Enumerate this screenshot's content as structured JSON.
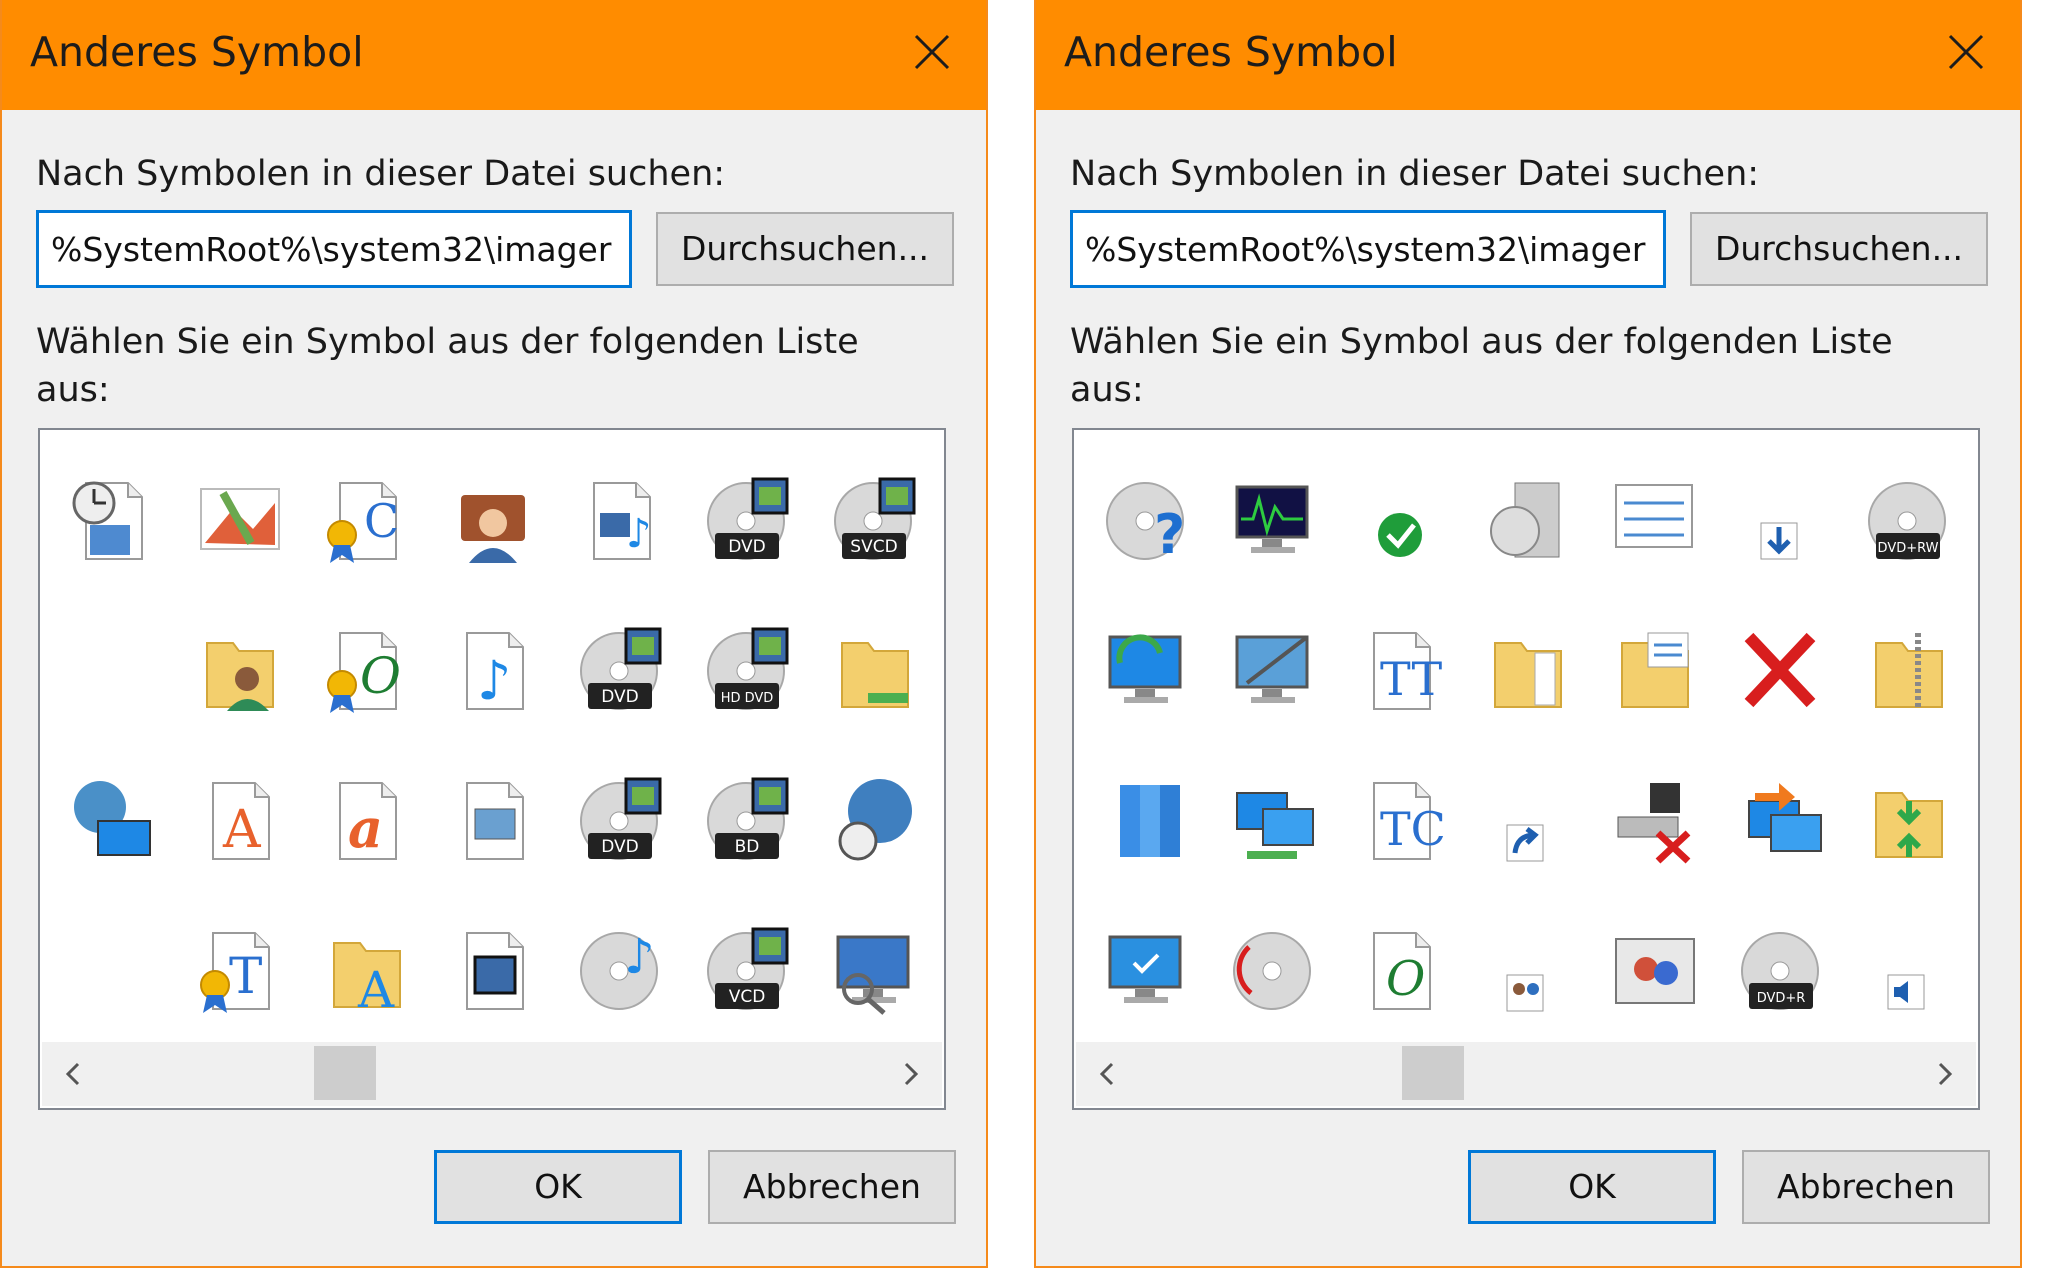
{
  "dialogs": [
    {
      "title": "Anderes Symbol",
      "search_label": "Nach Symbolen in dieser Datei suchen:",
      "path_value": "%SystemRoot%\\system32\\imager",
      "browse_label": "Durchsuchen...",
      "choose_label": "Wählen Sie ein Symbol aus der folgenden Liste aus:",
      "ok_label": "OK",
      "cancel_label": "Abbrechen",
      "icons": [
        {
          "icon": "clock-doc-icon",
          "badge": ""
        },
        {
          "icon": "map-picture-icon",
          "badge": ""
        },
        {
          "icon": "certificate-font-icon",
          "badge": ""
        },
        {
          "icon": "user-briefcase-icon",
          "badge": ""
        },
        {
          "icon": "video-music-doc-icon",
          "badge": ""
        },
        {
          "icon": "dvd-disc-icon",
          "badge": "DVD"
        },
        {
          "icon": "svcd-disc-icon",
          "badge": "SVCD"
        },
        {
          "icon": "blank-icon",
          "badge": ""
        },
        {
          "icon": "user-folder-icon",
          "badge": ""
        },
        {
          "icon": "certificate-opentype-icon",
          "badge": ""
        },
        {
          "icon": "music-doc-icon",
          "badge": ""
        },
        {
          "icon": "dvd-disc-icon",
          "badge": "DVD"
        },
        {
          "icon": "hddvd-disc-icon",
          "badge": "HD DVD"
        },
        {
          "icon": "network-folder-icon",
          "badge": ""
        },
        {
          "icon": "globe-network-icon",
          "badge": ""
        },
        {
          "icon": "font-a-doc-icon",
          "badge": ""
        },
        {
          "icon": "font-italic-a-icon",
          "badge": ""
        },
        {
          "icon": "picture-doc-icon",
          "badge": ""
        },
        {
          "icon": "dvd-disc-icon",
          "badge": "DVD"
        },
        {
          "icon": "bd-disc-icon",
          "badge": "BD"
        },
        {
          "icon": "globe-clock-icon",
          "badge": ""
        },
        {
          "icon": "blank-icon",
          "badge": ""
        },
        {
          "icon": "certificate-truetype-icon",
          "badge": ""
        },
        {
          "icon": "fonts-folder-icon",
          "badge": ""
        },
        {
          "icon": "video-doc-icon",
          "badge": ""
        },
        {
          "icon": "music-disc-icon",
          "badge": ""
        },
        {
          "icon": "vcd-disc-icon",
          "badge": "VCD"
        },
        {
          "icon": "monitor-magnifier-icon",
          "badge": ""
        }
      ]
    },
    {
      "title": "Anderes Symbol",
      "search_label": "Nach Symbolen in dieser Datei suchen:",
      "path_value": "%SystemRoot%\\system32\\imager",
      "browse_label": "Durchsuchen...",
      "choose_label": "Wählen Sie ein Symbol aus der folgenden Liste aus:",
      "ok_label": "OK",
      "cancel_label": "Abbrechen",
      "icons": [
        {
          "icon": "disc-question-icon",
          "badge": ""
        },
        {
          "icon": "performance-monitor-icon",
          "badge": ""
        },
        {
          "icon": "green-check-icon",
          "badge": ""
        },
        {
          "icon": "disc-box-icon",
          "badge": ""
        },
        {
          "icon": "checklist-window-icon",
          "badge": ""
        },
        {
          "icon": "download-arrow-icon",
          "badge": ""
        },
        {
          "icon": "dvdrw-disc-icon",
          "badge": "DVD+RW"
        },
        {
          "icon": "network-sync-icon",
          "badge": ""
        },
        {
          "icon": "monitor-pen-icon",
          "badge": ""
        },
        {
          "icon": "truetype-doc-icon",
          "badge": ""
        },
        {
          "icon": "document-folder-icon",
          "badge": ""
        },
        {
          "icon": "checklist-folder-icon",
          "badge": ""
        },
        {
          "icon": "red-x-icon",
          "badge": ""
        },
        {
          "icon": "zip-folder-icon",
          "badge": ""
        },
        {
          "icon": "blue-books-icon",
          "badge": ""
        },
        {
          "icon": "network-computers-icon",
          "badge": ""
        },
        {
          "icon": "font-tc-doc-icon",
          "badge": ""
        },
        {
          "icon": "shortcut-arrow-icon",
          "badge": ""
        },
        {
          "icon": "drive-disconnected-icon",
          "badge": ""
        },
        {
          "icon": "network-share-icon",
          "badge": ""
        },
        {
          "icon": "compress-folder-icon",
          "badge": ""
        },
        {
          "icon": "computer-check-icon",
          "badge": ""
        },
        {
          "icon": "disc-burn-icon",
          "badge": ""
        },
        {
          "icon": "opentype-doc-icon",
          "badge": ""
        },
        {
          "icon": "users-small-icon",
          "badge": ""
        },
        {
          "icon": "photo-people-icon",
          "badge": ""
        },
        {
          "icon": "dvdr-disc-icon",
          "badge": "DVD+R"
        },
        {
          "icon": "speaker-icon",
          "badge": ""
        }
      ]
    }
  ],
  "colors": {
    "titlebar": "#ff8c00",
    "accent": "#0078d7",
    "dialog_bg": "#f0f0f0"
  }
}
